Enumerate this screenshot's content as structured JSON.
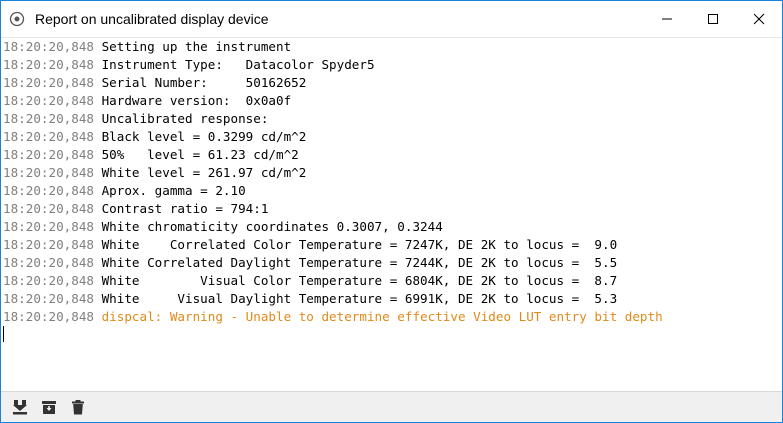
{
  "window": {
    "title": "Report on uncalibrated display device",
    "accent_color": "#1883d7"
  },
  "log": {
    "lines": [
      {
        "time": "18:20:20,848",
        "text": "Setting up the instrument",
        "level": "info"
      },
      {
        "time": "18:20:20,848",
        "text": "Instrument Type:   Datacolor Spyder5",
        "level": "info"
      },
      {
        "time": "18:20:20,848",
        "text": "Serial Number:     50162652",
        "level": "info"
      },
      {
        "time": "18:20:20,848",
        "text": "Hardware version:  0x0a0f",
        "level": "info"
      },
      {
        "time": "18:20:20,848",
        "text": "Uncalibrated response:",
        "level": "info"
      },
      {
        "time": "18:20:20,848",
        "text": "Black level = 0.3299 cd/m^2",
        "level": "info"
      },
      {
        "time": "18:20:20,848",
        "text": "50%   level = 61.23 cd/m^2",
        "level": "info"
      },
      {
        "time": "18:20:20,848",
        "text": "White level = 261.97 cd/m^2",
        "level": "info"
      },
      {
        "time": "18:20:20,848",
        "text": "Aprox. gamma = 2.10",
        "level": "info"
      },
      {
        "time": "18:20:20,848",
        "text": "Contrast ratio = 794:1",
        "level": "info"
      },
      {
        "time": "18:20:20,848",
        "text": "White chromaticity coordinates 0.3007, 0.3244",
        "level": "info"
      },
      {
        "time": "18:20:20,848",
        "text": "White    Correlated Color Temperature = 7247K, DE 2K to locus =  9.0",
        "level": "info"
      },
      {
        "time": "18:20:20,848",
        "text": "White Correlated Daylight Temperature = 7244K, DE 2K to locus =  5.5",
        "level": "info"
      },
      {
        "time": "18:20:20,848",
        "text": "White        Visual Color Temperature = 6804K, DE 2K to locus =  8.7",
        "level": "info"
      },
      {
        "time": "18:20:20,848",
        "text": "White     Visual Daylight Temperature = 6991K, DE 2K to locus =  5.3",
        "level": "info"
      },
      {
        "time": "18:20:20,848",
        "text": "dispcal: Warning - Unable to determine effective Video LUT entry bit depth",
        "level": "warning"
      }
    ],
    "colors": {
      "timestamp": "#808080",
      "text": "#000000",
      "warning": "#e08a1a"
    }
  },
  "toolbar": {
    "icons": [
      "save-icon",
      "archive-icon",
      "trash-icon"
    ]
  }
}
